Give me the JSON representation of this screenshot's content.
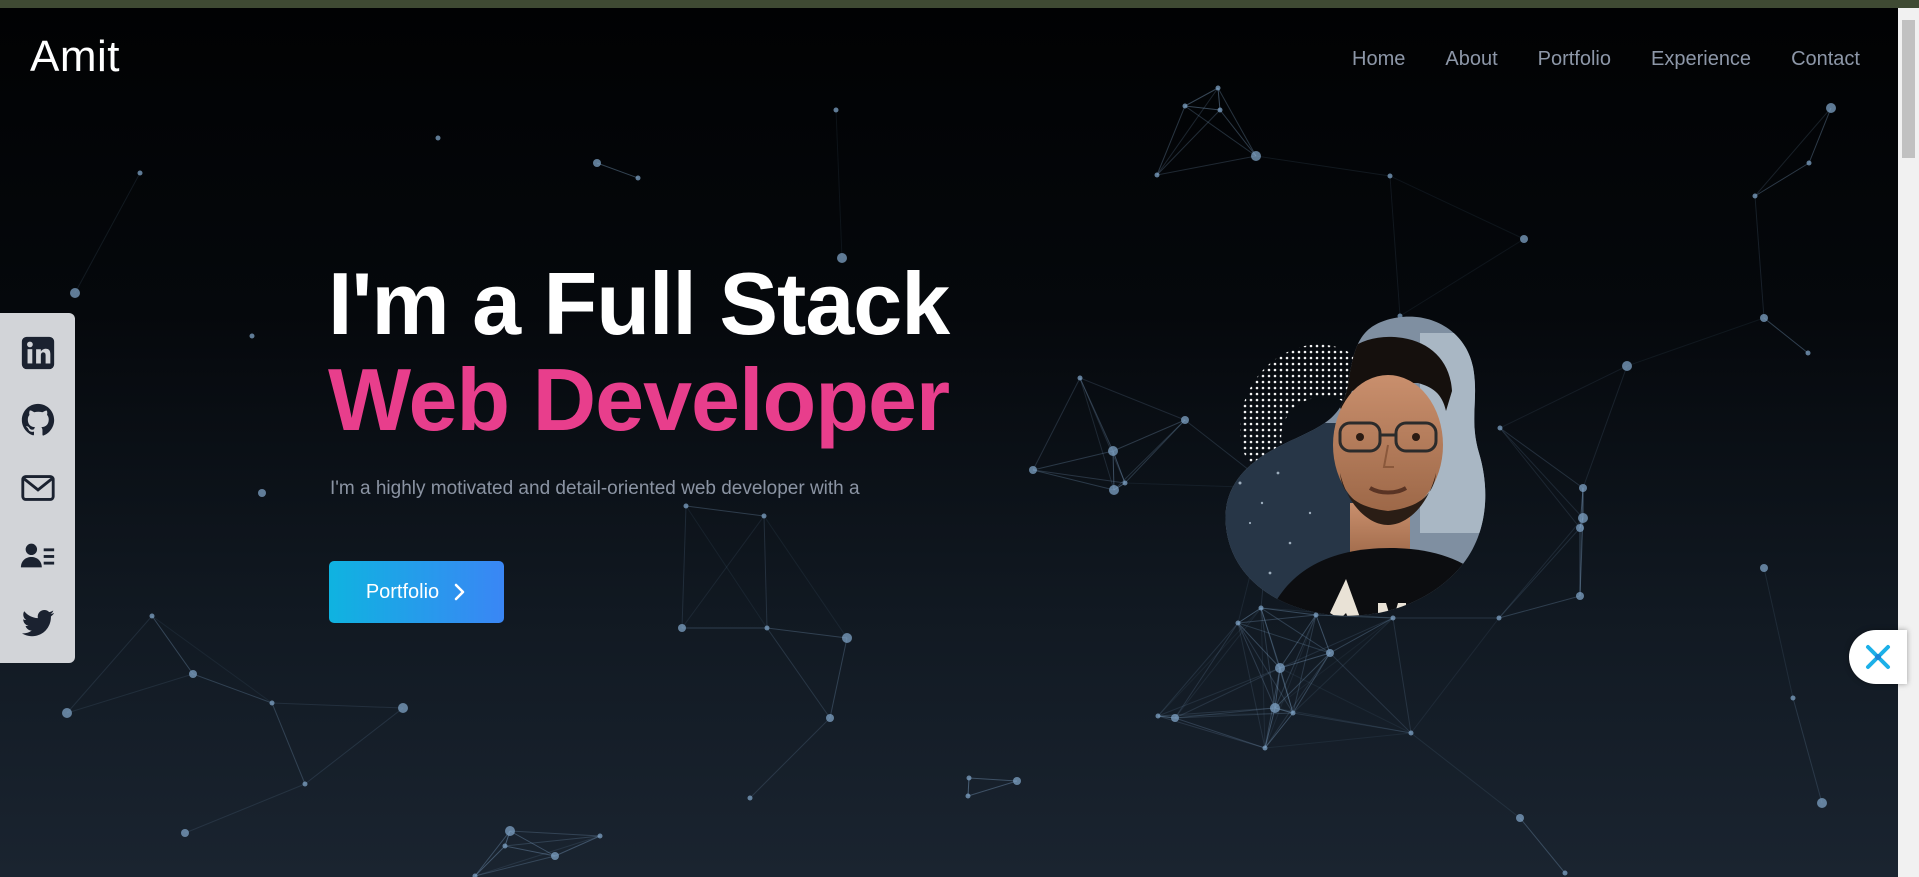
{
  "header": {
    "brand": "Amit",
    "nav": [
      "Home",
      "About",
      "Portfolio",
      "Experience",
      "Contact"
    ]
  },
  "social": [
    {
      "name": "linkedin",
      "icon": "linkedin-icon"
    },
    {
      "name": "github",
      "icon": "github-icon"
    },
    {
      "name": "email",
      "icon": "mail-icon"
    },
    {
      "name": "resume",
      "icon": "contact-card-icon"
    },
    {
      "name": "twitter",
      "icon": "twitter-icon"
    }
  ],
  "hero": {
    "line1": "I'm a Full Stack",
    "line2": "Web Developer",
    "description": "I'm a highly motivated and detail-oriented web developer with a",
    "cta_label": "Portfolio"
  },
  "colors": {
    "accent_pink": "#e83e8c",
    "cta_start": "#0fb3e0",
    "cta_end": "#3a86f5",
    "nav_text": "#8d97a8",
    "particles": "#7ea1c4"
  }
}
